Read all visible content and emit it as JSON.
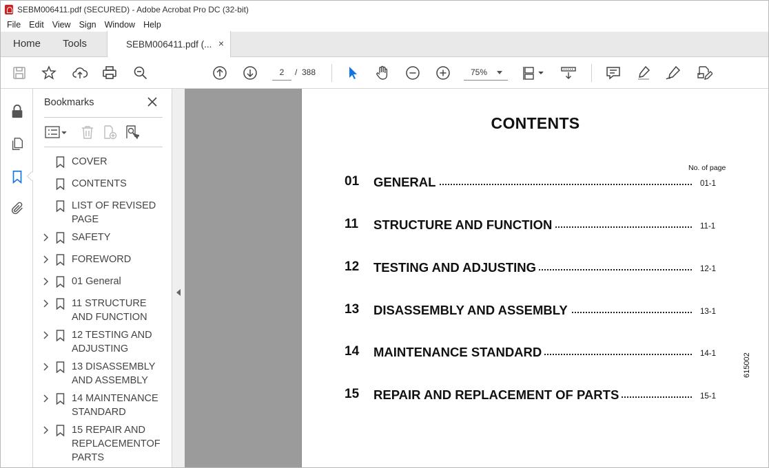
{
  "window": {
    "title": "SEBM006411.pdf (SECURED) - Adobe Acrobat Pro DC (32-bit)"
  },
  "menu": [
    "File",
    "Edit",
    "View",
    "Sign",
    "Window",
    "Help"
  ],
  "tabs": {
    "home": "Home",
    "tools": "Tools",
    "document": "SEBM006411.pdf (...",
    "close_glyph": "×"
  },
  "toolbar": {
    "current_page": "2",
    "page_separator": "/",
    "total_pages": "388",
    "zoom": "75%",
    "accent_color": "#1473e6"
  },
  "bookmarks": {
    "header": "Bookmarks",
    "items": [
      {
        "label": "COVER",
        "expandable": false
      },
      {
        "label": "CONTENTS",
        "expandable": false
      },
      {
        "label": "LIST OF REVISED PAGE",
        "expandable": false
      },
      {
        "label": "SAFETY",
        "expandable": true
      },
      {
        "label": "FOREWORD",
        "expandable": true
      },
      {
        "label": "01 General",
        "expandable": true
      },
      {
        "label": "11 STRUCTURE AND FUNCTION",
        "expandable": true
      },
      {
        "label": "12 TESTING AND ADJUSTING",
        "expandable": true
      },
      {
        "label": "13 DISASSEMBLY AND ASSEMBLY",
        "expandable": true
      },
      {
        "label": "14 MAINTENANCE STANDARD",
        "expandable": true
      },
      {
        "label": "15 REPAIR AND REPLACEMENTOF PARTS",
        "expandable": true
      }
    ]
  },
  "document": {
    "title": "CONTENTS",
    "no_of_page_label": "No. of page",
    "entries": [
      {
        "number": "01",
        "title": "GENERAL",
        "page": "01-1"
      },
      {
        "number": "11",
        "title": "STRUCTURE AND FUNCTION",
        "page": "11-1"
      },
      {
        "number": "12",
        "title": "TESTING AND ADJUSTING",
        "page": "12-1"
      },
      {
        "number": "13",
        "title": "DISASSEMBLY AND ASSEMBLY",
        "page": "13-1"
      },
      {
        "number": "14",
        "title": "MAINTENANCE STANDARD",
        "page": "14-1"
      },
      {
        "number": "15",
        "title": "REPAIR AND REPLACEMENT OF PARTS",
        "page": "15-1"
      }
    ],
    "side_code": "615002"
  }
}
